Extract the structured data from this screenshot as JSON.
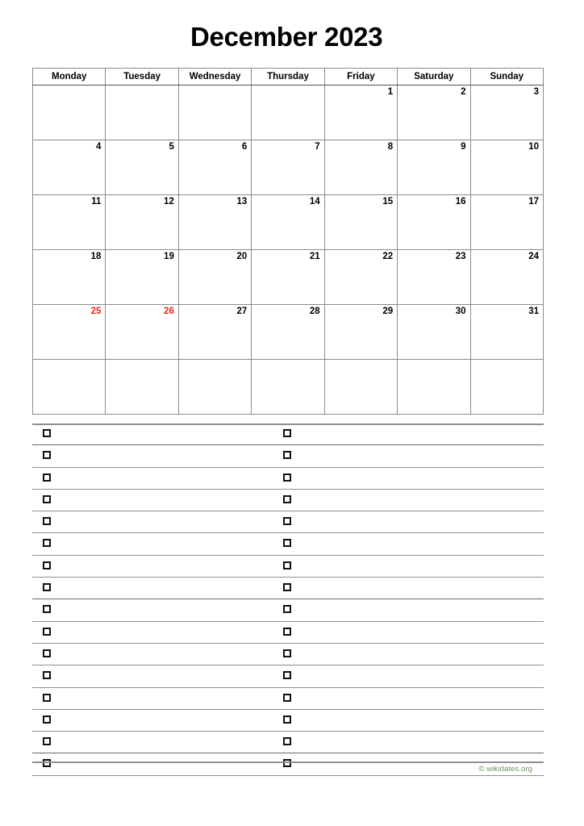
{
  "page": {
    "title": "December 2023",
    "month": "December",
    "year": "2023"
  },
  "calendar": {
    "weekday_headers": [
      "Monday",
      "Tuesday",
      "Wednesday",
      "Thursday",
      "Friday",
      "Saturday",
      "Sunday"
    ],
    "weeks": [
      [
        {
          "day": "",
          "holiday": false
        },
        {
          "day": "",
          "holiday": false
        },
        {
          "day": "",
          "holiday": false
        },
        {
          "day": "",
          "holiday": false
        },
        {
          "day": "1",
          "holiday": false
        },
        {
          "day": "2",
          "holiday": false
        },
        {
          "day": "3",
          "holiday": false
        }
      ],
      [
        {
          "day": "4",
          "holiday": false
        },
        {
          "day": "5",
          "holiday": false
        },
        {
          "day": "6",
          "holiday": false
        },
        {
          "day": "7",
          "holiday": false
        },
        {
          "day": "8",
          "holiday": false
        },
        {
          "day": "9",
          "holiday": false
        },
        {
          "day": "10",
          "holiday": false
        }
      ],
      [
        {
          "day": "11",
          "holiday": false
        },
        {
          "day": "12",
          "holiday": false
        },
        {
          "day": "13",
          "holiday": false
        },
        {
          "day": "14",
          "holiday": false
        },
        {
          "day": "15",
          "holiday": false
        },
        {
          "day": "16",
          "holiday": false
        },
        {
          "day": "17",
          "holiday": false
        }
      ],
      [
        {
          "day": "18",
          "holiday": false
        },
        {
          "day": "19",
          "holiday": false
        },
        {
          "day": "20",
          "holiday": false
        },
        {
          "day": "21",
          "holiday": false
        },
        {
          "day": "22",
          "holiday": false
        },
        {
          "day": "23",
          "holiday": false
        },
        {
          "day": "24",
          "holiday": false
        }
      ],
      [
        {
          "day": "25",
          "holiday": true
        },
        {
          "day": "26",
          "holiday": true
        },
        {
          "day": "27",
          "holiday": false
        },
        {
          "day": "28",
          "holiday": false
        },
        {
          "day": "29",
          "holiday": false
        },
        {
          "day": "30",
          "holiday": false
        },
        {
          "day": "31",
          "holiday": false
        }
      ],
      [
        {
          "day": "",
          "holiday": false
        },
        {
          "day": "",
          "holiday": false
        },
        {
          "day": "",
          "holiday": false
        },
        {
          "day": "",
          "holiday": false
        },
        {
          "day": "",
          "holiday": false
        },
        {
          "day": "",
          "holiday": false
        },
        {
          "day": "",
          "holiday": false
        }
      ]
    ],
    "holiday_color": "#e8261c",
    "text_color": "#000000",
    "grid_color": "#8c8c8c"
  },
  "notes": {
    "row_count": 16,
    "checkbox_columns": 2,
    "rows": [
      {
        "checkbox_1": "unchecked",
        "checkbox_2": "unchecked",
        "text_1": "",
        "text_2": ""
      },
      {
        "checkbox_1": "unchecked",
        "checkbox_2": "unchecked",
        "text_1": "",
        "text_2": ""
      },
      {
        "checkbox_1": "unchecked",
        "checkbox_2": "unchecked",
        "text_1": "",
        "text_2": ""
      },
      {
        "checkbox_1": "unchecked",
        "checkbox_2": "unchecked",
        "text_1": "",
        "text_2": ""
      },
      {
        "checkbox_1": "unchecked",
        "checkbox_2": "unchecked",
        "text_1": "",
        "text_2": ""
      },
      {
        "checkbox_1": "unchecked",
        "checkbox_2": "unchecked",
        "text_1": "",
        "text_2": ""
      },
      {
        "checkbox_1": "unchecked",
        "checkbox_2": "unchecked",
        "text_1": "",
        "text_2": ""
      },
      {
        "checkbox_1": "unchecked",
        "checkbox_2": "unchecked",
        "text_1": "",
        "text_2": ""
      },
      {
        "checkbox_1": "unchecked",
        "checkbox_2": "unchecked",
        "text_1": "",
        "text_2": ""
      },
      {
        "checkbox_1": "unchecked",
        "checkbox_2": "unchecked",
        "text_1": "",
        "text_2": ""
      },
      {
        "checkbox_1": "unchecked",
        "checkbox_2": "unchecked",
        "text_1": "",
        "text_2": ""
      },
      {
        "checkbox_1": "unchecked",
        "checkbox_2": "unchecked",
        "text_1": "",
        "text_2": ""
      },
      {
        "checkbox_1": "unchecked",
        "checkbox_2": "unchecked",
        "text_1": "",
        "text_2": ""
      },
      {
        "checkbox_1": "unchecked",
        "checkbox_2": "unchecked",
        "text_1": "",
        "text_2": ""
      },
      {
        "checkbox_1": "unchecked",
        "checkbox_2": "unchecked",
        "text_1": "",
        "text_2": ""
      },
      {
        "checkbox_1": "unchecked",
        "checkbox_2": "unchecked",
        "text_1": "",
        "text_2": ""
      }
    ]
  },
  "footer": {
    "credit": "© wikidates.org",
    "credit_color": "#6f8f5c"
  }
}
